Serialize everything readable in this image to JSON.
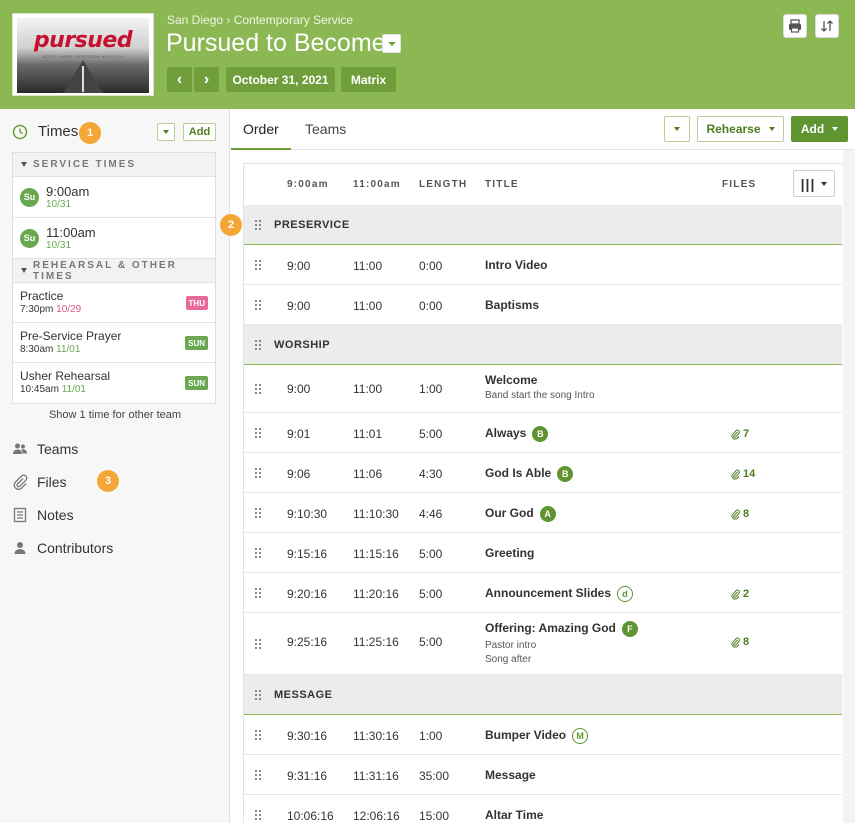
{
  "header": {
    "brand": "pursued",
    "brand_tagline": "GOD'S DIVINE OBSESSION WITH YOU",
    "breadcrumb": "San Diego › Contemporary Service",
    "title": "Pursued to Become",
    "date": "October 31, 2021",
    "matrix": "Matrix",
    "prev": "‹",
    "next": "›"
  },
  "sidebar": {
    "times_label": "Times",
    "badge1": "1",
    "add": "Add",
    "service_head": "SERVICE TIMES",
    "service_times": [
      {
        "day": "Su",
        "time": "9:00am",
        "date": "10/31"
      },
      {
        "day": "Su",
        "time": "11:00am",
        "date": "10/31"
      }
    ],
    "rehearsal_head": "REHEARSAL & OTHER TIMES",
    "rehearsals": [
      {
        "name": "Practice",
        "time": "7:30pm",
        "date": "10/29",
        "day": "THU"
      },
      {
        "name": "Pre-Service Prayer",
        "time": "8:30am",
        "date": "11/01",
        "day": "SUN"
      },
      {
        "name": "Usher Rehearsal",
        "time": "10:45am",
        "date": "11/01",
        "day": "SUN"
      }
    ],
    "show_other": "Show 1 time for other team",
    "nav": {
      "teams": "Teams",
      "files": "Files",
      "notes": "Notes",
      "contributors": "Contributors"
    },
    "badge3": "3"
  },
  "tabs": {
    "order": "Order",
    "teams": "Teams"
  },
  "toolbar": {
    "rehearse": "Rehearse",
    "add": "Add"
  },
  "columns": {
    "t1": "9:00am",
    "t2": "11:00am",
    "length": "LENGTH",
    "title": "TITLE",
    "files": "FILES",
    "col_icon": "|||"
  },
  "badge2": "2",
  "sections": [
    {
      "name": "PRESERVICE",
      "items": [
        {
          "t1": "9:00",
          "t2": "11:00",
          "len": "0:00",
          "title": "Intro Video"
        },
        {
          "t1": "9:00",
          "t2": "11:00",
          "len": "0:00",
          "title": "Baptisms"
        }
      ]
    },
    {
      "name": "WORSHIP",
      "items": [
        {
          "t1": "9:00",
          "t2": "11:00",
          "len": "1:00",
          "title": "Welcome",
          "notes": [
            "Band start the song Intro"
          ]
        },
        {
          "t1": "9:01",
          "t2": "11:01",
          "len": "5:00",
          "title": "Always",
          "key": "B",
          "files": "7"
        },
        {
          "t1": "9:06",
          "t2": "11:06",
          "len": "4:30",
          "title": "God Is Able",
          "key": "B",
          "files": "14"
        },
        {
          "t1": "9:10:30",
          "t2": "11:10:30",
          "len": "4:46",
          "title": "Our God",
          "key": "A",
          "files": "8"
        },
        {
          "t1": "9:15:16",
          "t2": "11:15:16",
          "len": "5:00",
          "title": "Greeting"
        },
        {
          "t1": "9:20:16",
          "t2": "11:20:16",
          "len": "5:00",
          "title": "Announcement Slides",
          "key": "d",
          "key_outline": true,
          "files": "2"
        },
        {
          "t1": "9:25:16",
          "t2": "11:25:16",
          "len": "5:00",
          "title": "Offering: Amazing God",
          "key": "F",
          "files": "8",
          "notes": [
            "Pastor intro",
            "Song after"
          ]
        }
      ]
    },
    {
      "name": "MESSAGE",
      "items": [
        {
          "t1": "9:30:16",
          "t2": "11:30:16",
          "len": "1:00",
          "title": "Bumper Video",
          "key": "M",
          "key_outline": true
        },
        {
          "t1": "9:31:16",
          "t2": "11:31:16",
          "len": "35:00",
          "title": "Message"
        },
        {
          "t1": "10:06:16",
          "t2": "12:06:16",
          "len": "15:00",
          "title": "Altar Time"
        }
      ]
    }
  ],
  "colors": {
    "header_green": "#8cb854",
    "button_green": "#6f9e3b",
    "badge_orange": "#f4a736",
    "pink_day": "#e86a9c"
  }
}
